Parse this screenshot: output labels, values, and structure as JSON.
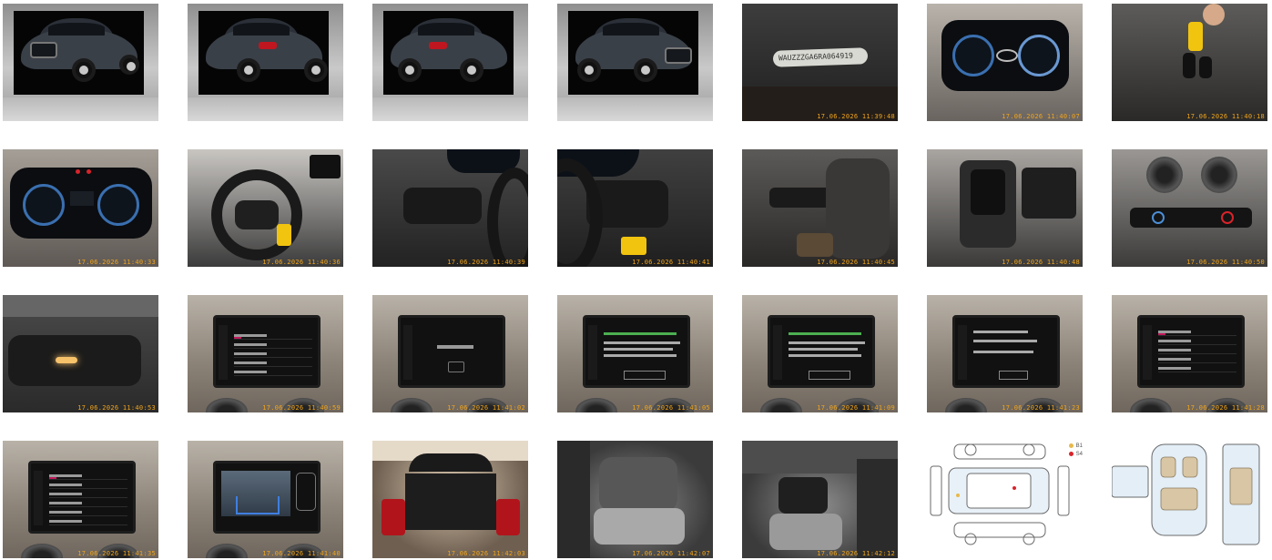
{
  "gallery": {
    "photos": [
      {
        "kind": "studio",
        "timestamp": ""
      },
      {
        "kind": "studio",
        "timestamp": ""
      },
      {
        "kind": "studio",
        "timestamp": ""
      },
      {
        "kind": "studio",
        "timestamp": ""
      },
      {
        "kind": "vin-plate",
        "timestamp": "17.06.2026 11:39:48",
        "plate_text": "WAUZZZGA6RA064919"
      },
      {
        "kind": "instrument-cluster",
        "timestamp": "17.06.2026 11:40:07"
      },
      {
        "kind": "key",
        "timestamp": "17.06.2026 11:40:18"
      },
      {
        "kind": "instrument-cluster",
        "timestamp": "17.06.2026 11:40:33"
      },
      {
        "kind": "steering-wheel",
        "timestamp": "17.06.2026 11:40:36"
      },
      {
        "kind": "steering-buttons",
        "timestamp": "17.06.2026 11:40:39"
      },
      {
        "kind": "steering-buttons",
        "timestamp": "17.06.2026 11:40:41"
      },
      {
        "kind": "light-switch",
        "timestamp": "17.06.2026 11:40:45"
      },
      {
        "kind": "gear-selector",
        "timestamp": "17.06.2026 11:40:48"
      },
      {
        "kind": "climate-panel",
        "timestamp": "17.06.2026 11:40:50"
      },
      {
        "kind": "rear-mirror",
        "timestamp": "17.06.2026 11:40:53"
      },
      {
        "kind": "infotainment",
        "timestamp": "17.06.2026 11:40:59"
      },
      {
        "kind": "infotainment",
        "timestamp": "17.06.2026 11:41:02"
      },
      {
        "kind": "infotainment",
        "timestamp": "17.06.2026 11:41:05"
      },
      {
        "kind": "infotainment",
        "timestamp": "17.06.2026 11:41:09"
      },
      {
        "kind": "infotainment",
        "timestamp": "17.06.2026 11:41:23"
      },
      {
        "kind": "infotainment",
        "timestamp": "17.06.2026 11:41:28"
      },
      {
        "kind": "infotainment",
        "timestamp": "17.06.2026 11:41:35"
      },
      {
        "kind": "reverse-camera",
        "timestamp": "17.06.2026 11:41:40"
      },
      {
        "kind": "trunk",
        "timestamp": "17.06.2026 11:42:03"
      },
      {
        "kind": "rear-seat",
        "timestamp": "17.06.2026 11:42:07"
      },
      {
        "kind": "front-seat",
        "timestamp": "17.06.2026 11:42:12"
      },
      {
        "kind": "damage-diagram-exterior",
        "timestamp": ""
      },
      {
        "kind": "damage-diagram-interior",
        "timestamp": ""
      }
    ],
    "infotainment_text": {
      "s16": [
        "DR P5 Syd",
        "DR P4 Jazz",
        "DR P5 Jazz",
        "DR P3 Jazz",
        "P1 Sveriges Radio"
      ],
      "s22": [
        "Førerassistance",
        "Adaptiv fartpilot",
        "Audi pre sense",
        "Vognbaneholdeassistent",
        "Parkeringshjælp",
        "Trafikskiltsassistent"
      ]
    },
    "diagram_legend": [
      {
        "code": "B1",
        "color": "#e8b84a"
      },
      {
        "code": "S4",
        "color": "#d8232a"
      }
    ],
    "colors": {
      "timestamp": "#f2a51a",
      "accent": "#c2185b"
    }
  }
}
